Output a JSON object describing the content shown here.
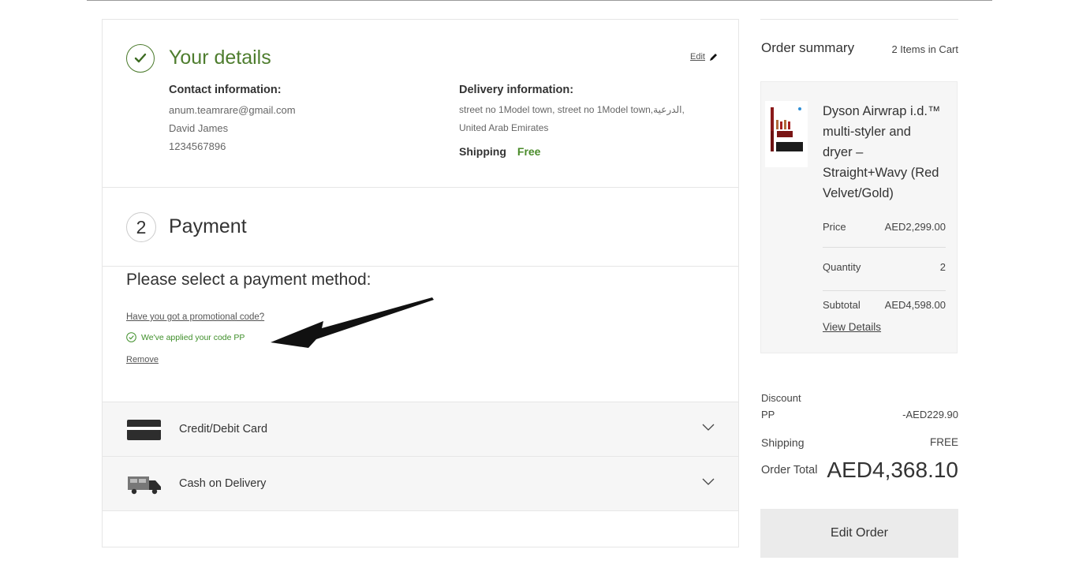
{
  "details": {
    "title": "Your details",
    "edit_label": "Edit",
    "contact": {
      "heading": "Contact information:",
      "email": "anum.teamrare@gmail.com",
      "name": "David James",
      "phone": "1234567896"
    },
    "delivery": {
      "heading": "Delivery information:",
      "address_line1": "street no 1Model town, street no 1Model town,الدرعية,",
      "address_line2": "United Arab Emirates",
      "shipping_label": "Shipping",
      "shipping_value": "Free"
    }
  },
  "payment": {
    "step_number": "2",
    "title": "Payment",
    "select_title": "Please select a payment method:",
    "promo_link": "Have you got a promotional code?",
    "applied_text": "We've applied your code PP",
    "remove_label": "Remove",
    "methods": [
      {
        "label": "Credit/Debit Card",
        "icon": "credit-card-icon"
      },
      {
        "label": "Cash on Delivery",
        "icon": "delivery-truck-icon"
      }
    ]
  },
  "summary": {
    "title": "Order summary",
    "items_in_cart": "2 Items in Cart",
    "product": {
      "name": "Dyson Airwrap i.d.™ multi-styler and dryer – Straight+Wavy (Red Velvet/Gold)",
      "price_label": "Price",
      "price": "AED2,299.00",
      "quantity_label": "Quantity",
      "quantity": "2",
      "subtotal_label": "Subtotal",
      "subtotal": "AED4,598.00",
      "view_details": "View Details"
    },
    "discount_label": "Discount",
    "discount_code": "PP",
    "discount_value": "-AED229.90",
    "shipping_label": "Shipping",
    "shipping_value": "FREE",
    "total_label": "Order Total",
    "total_value": "AED4,368.10",
    "edit_order": "Edit Order"
  },
  "colors": {
    "accent_green": "#4e7d2e",
    "success_green": "#3f8f2a",
    "panel_gray": "#f6f6f6"
  }
}
